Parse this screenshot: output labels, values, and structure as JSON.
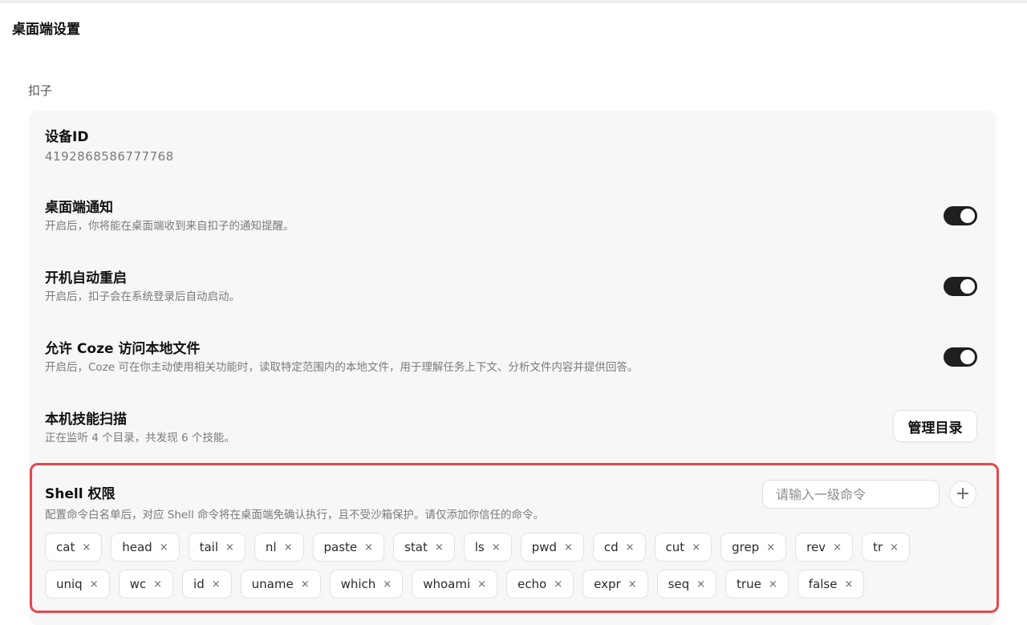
{
  "page": {
    "title": "桌面端设置"
  },
  "section": {
    "label": "扣子"
  },
  "device": {
    "title": "设备ID",
    "id": "4192868586777768"
  },
  "settings": [
    {
      "title": "桌面端通知",
      "desc": "开启后，你将能在桌面端收到来自扣子的通知提醒。",
      "enabled": true
    },
    {
      "title": "开机自动重启",
      "desc": "开启后，扣子会在系统登录后自动启动。",
      "enabled": true
    },
    {
      "title": "允许 Coze 访问本地文件",
      "desc": "开启后，Coze 可在你主动使用相关功能时，读取特定范围内的本地文件，用于理解任务上下文、分析文件内容并提供回答。",
      "enabled": true
    }
  ],
  "skills": {
    "title": "本机技能扫描",
    "desc": "正在监听 4 个目录，共发现 6 个技能。",
    "button": "管理目录"
  },
  "shell": {
    "title": "Shell 权限",
    "desc": "配置命令白名单后，对应 Shell 命令将在桌面端免确认执行，且不受沙箱保护。请仅添加你信任的命令。",
    "input_placeholder": "请输入一级命令",
    "add_label": "+",
    "remove_label": "×",
    "commands_row1": [
      "cat",
      "head",
      "tail",
      "nl",
      "paste",
      "stat",
      "ls",
      "pwd",
      "cd",
      "cut",
      "grep",
      "rev",
      "tr"
    ],
    "commands_row2": [
      "uniq",
      "wc",
      "id",
      "uname",
      "which",
      "whoami",
      "echo",
      "expr",
      "seq",
      "true",
      "false"
    ]
  },
  "colors": {
    "highlight": "#e5484d",
    "toggle_on": "#1f1f1f",
    "card_bg": "#f7f7f7"
  }
}
